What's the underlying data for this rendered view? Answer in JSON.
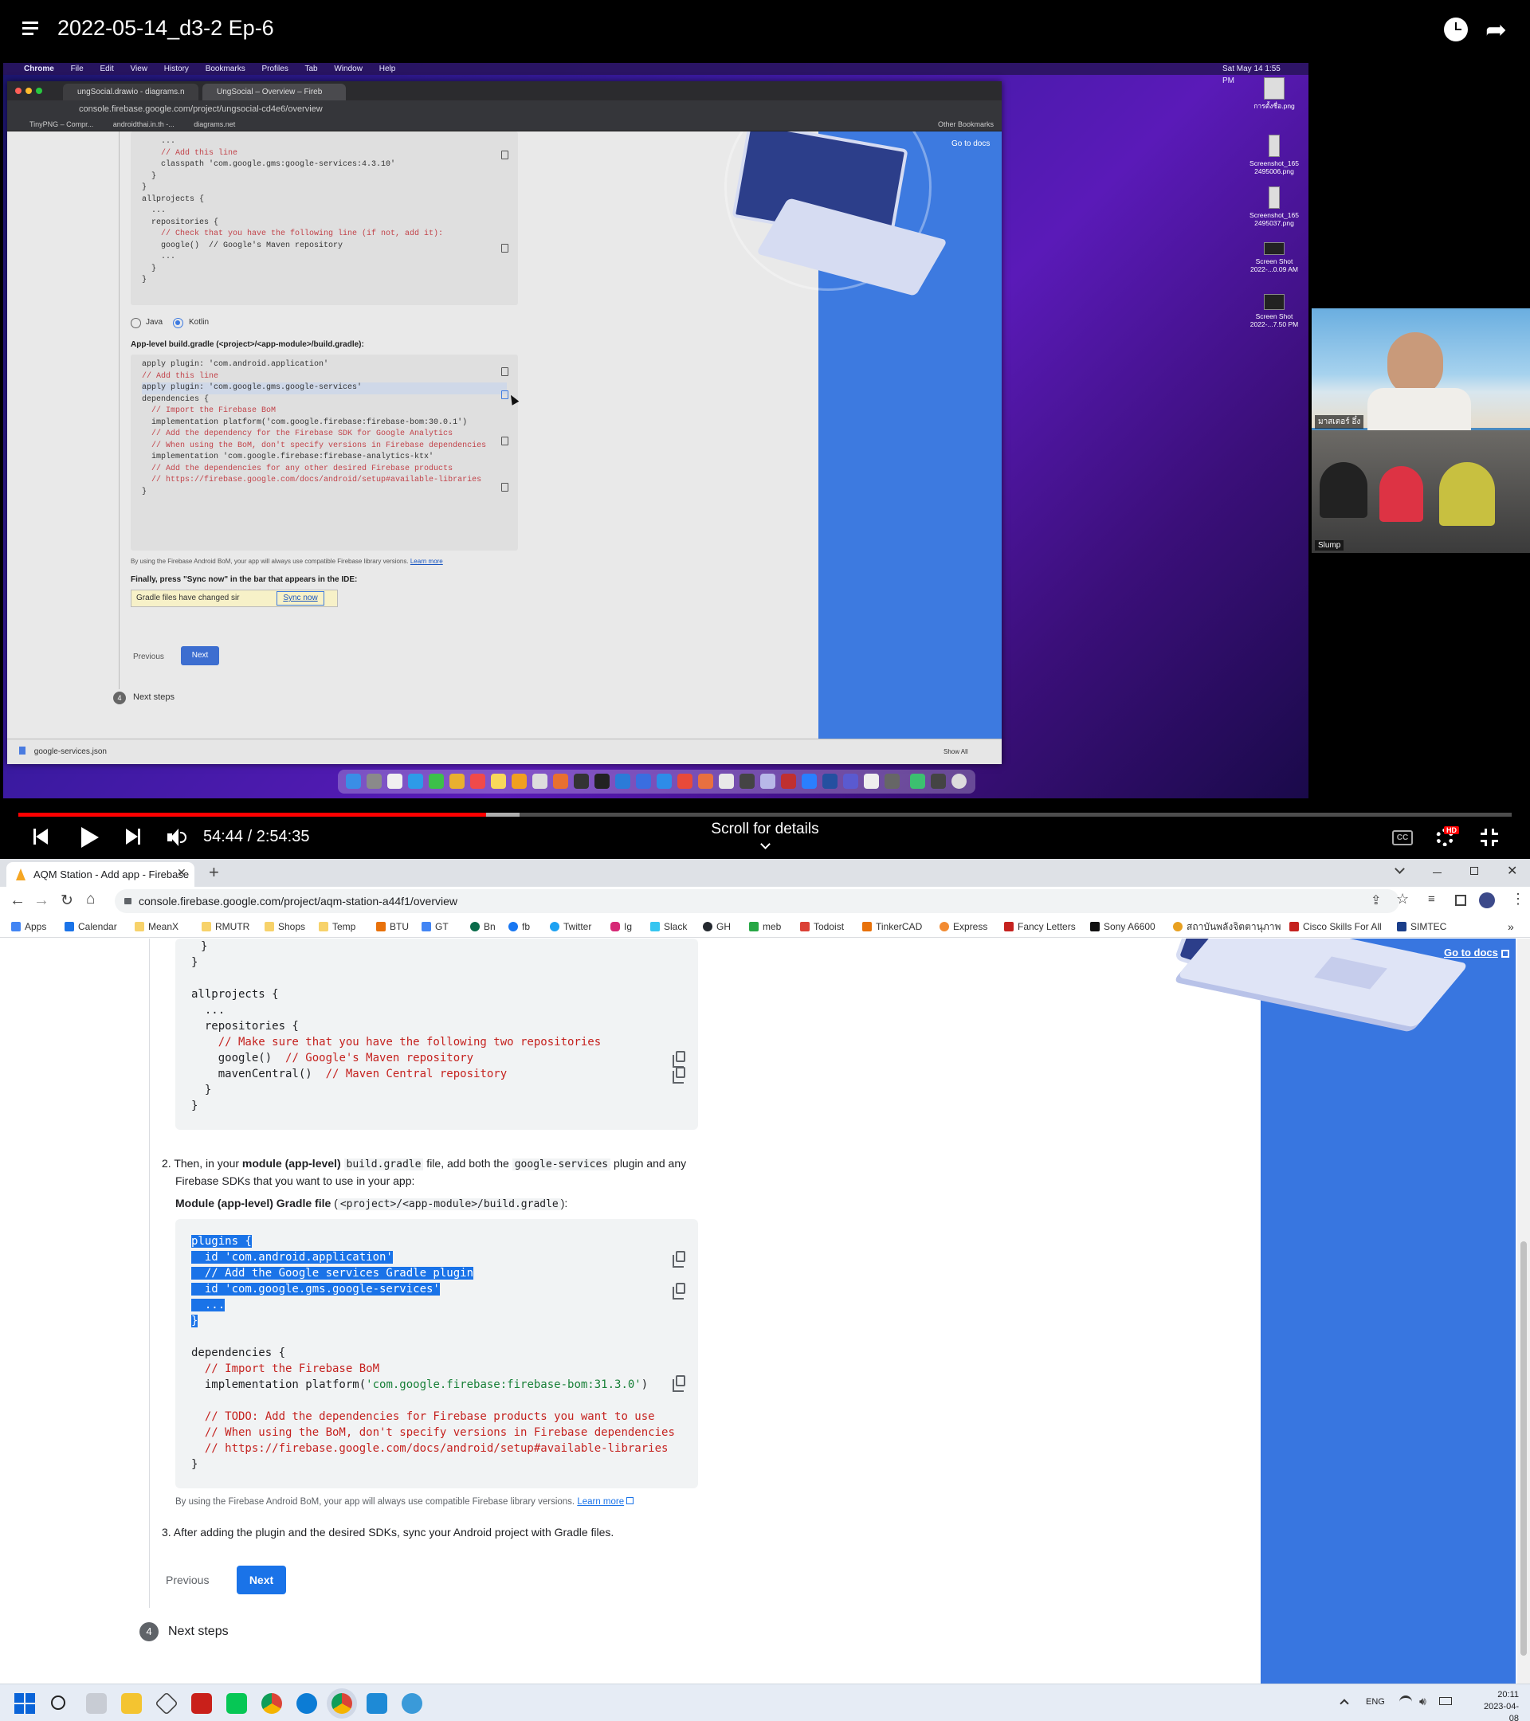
{
  "player": {
    "title": "2022-05-14_d3-2 Ep-6",
    "time": "54:44 / 2:54:35",
    "scroll_hint": "Scroll for details",
    "progress": 0.3135,
    "buffered": 0.3355,
    "hd_badge": "HD",
    "cc_label": "CC"
  },
  "recorded_screen": {
    "menubar": [
      "Chrome",
      "File",
      "Edit",
      "View",
      "History",
      "Bookmarks",
      "Profiles",
      "Tab",
      "Window",
      "Help"
    ],
    "clock": "Sat May 14  1:55 PM",
    "tabs": [
      "ungSocial.drawio - diagrams.n",
      "UngSocial – Overview – Fireb"
    ],
    "url": "console.firebase.google.com/project/ungsocial-cd4e6/overview",
    "bookmarks": [
      "TinyPNG – Compr...",
      "androidthai.in.th -...",
      "diagrams.net"
    ],
    "other_bookmarks": "Other Bookmarks",
    "go_to_docs": "Go to docs",
    "code1": [
      "    ...",
      "    // Add this line",
      "    classpath 'com.google.gms:google-services:4.3.10'",
      "  }",
      "}",
      "",
      "allprojects {",
      "  ...",
      "  repositories {",
      "    // Check that you have the following line (if not, add it):",
      "    google()  // Google's Maven repository",
      "    ...",
      "  }",
      "}"
    ],
    "radio_java": "Java",
    "radio_kotlin": "Kotlin",
    "app_level_label": "App-level build.gradle (<project>/<app-module>/build.gradle):",
    "code2": [
      "apply plugin: 'com.android.application'",
      "// Add this line",
      "apply plugin: 'com.google.gms.google-services'",
      "",
      "dependencies {",
      "  // Import the Firebase BoM",
      "  implementation platform('com.google.firebase:firebase-bom:30.0.1')",
      "",
      "  // Add the dependency for the Firebase SDK for Google Analytics",
      "  // When using the BoM, don't specify versions in Firebase dependencies",
      "  implementation 'com.google.firebase:firebase-analytics-ktx'",
      "",
      "  // Add the dependencies for any other desired Firebase products",
      "  // https://firebase.google.com/docs/android/setup#available-libraries",
      "}"
    ],
    "bom_note": "By using the Firebase Android BoM, your app will always use compatible Firebase library versions.",
    "learn_more": "Learn more",
    "finally": "Finally, press \"Sync now\" in the bar that appears in the IDE:",
    "gradle_changed": "Gradle files have changed sir",
    "sync_now": "Sync now",
    "previous": "Previous",
    "next": "Next",
    "step_number": "4",
    "next_steps": "Next steps",
    "download_file": "google-services.json",
    "show_all": "Show All",
    "desktop_icons": [
      {
        "label": "การตั้งชื่อ.png"
      },
      {
        "label": "Screenshot_165 2495006.png"
      },
      {
        "label": "Screenshot_165 2495037.png"
      },
      {
        "label": "Screen Shot 2022-...0.09 AM"
      },
      {
        "label": "Screen Shot 2022-...7.50 PM"
      }
    ]
  },
  "webcam": {
    "name_top": "มาสเตอร์ อึ๋ง",
    "name_bottom": "Slump"
  },
  "browser": {
    "tab_title": "AQM Station - Add app - Firebase",
    "url": "console.firebase.google.com/project/aqm-station-a44f1/overview",
    "bookmarks": [
      "Apps",
      "Calendar",
      "MeanX",
      "RMUTR",
      "Shops",
      "Temp",
      "BTU",
      "GT",
      "Bn",
      "fb",
      "Twitter",
      "Ig",
      "Slack",
      "GH",
      "meb",
      "Todoist",
      "TinkerCAD",
      "Express",
      "Fancy Letters",
      "Sony A6600",
      "สถาบันพลังจิตตานุภาพ",
      "Cisco Skills For All",
      "SIMTEC"
    ],
    "go_to_docs": "Go to docs",
    "step2_pre": "2. Then, in your ",
    "step2_bold": "module (app-level)",
    "step2_mid1": " ",
    "step2_code1": "build.gradle",
    "step2_mid2": " file, add both the ",
    "step2_code2": "google-services",
    "step2_post": " plugin and any",
    "step2_line2": "Firebase SDKs that you want to use in your app:",
    "module_label_bold": "Module (app-level) Gradle file",
    "module_label_code": "<project>/<app-module>/build.gradle",
    "bom_note": "By using the Firebase Android BoM, your app will always use compatible Firebase library versions.",
    "learn_more": "Learn more",
    "step3": "3. After adding the plugin and the desired SDKs, sync your Android project with Gradle files.",
    "previous": "Previous",
    "next": "Next",
    "step_number": "4",
    "next_steps": "Next steps"
  },
  "taskbar": {
    "lang": "ENG",
    "time": "20:11",
    "date": "2023-04-08"
  }
}
